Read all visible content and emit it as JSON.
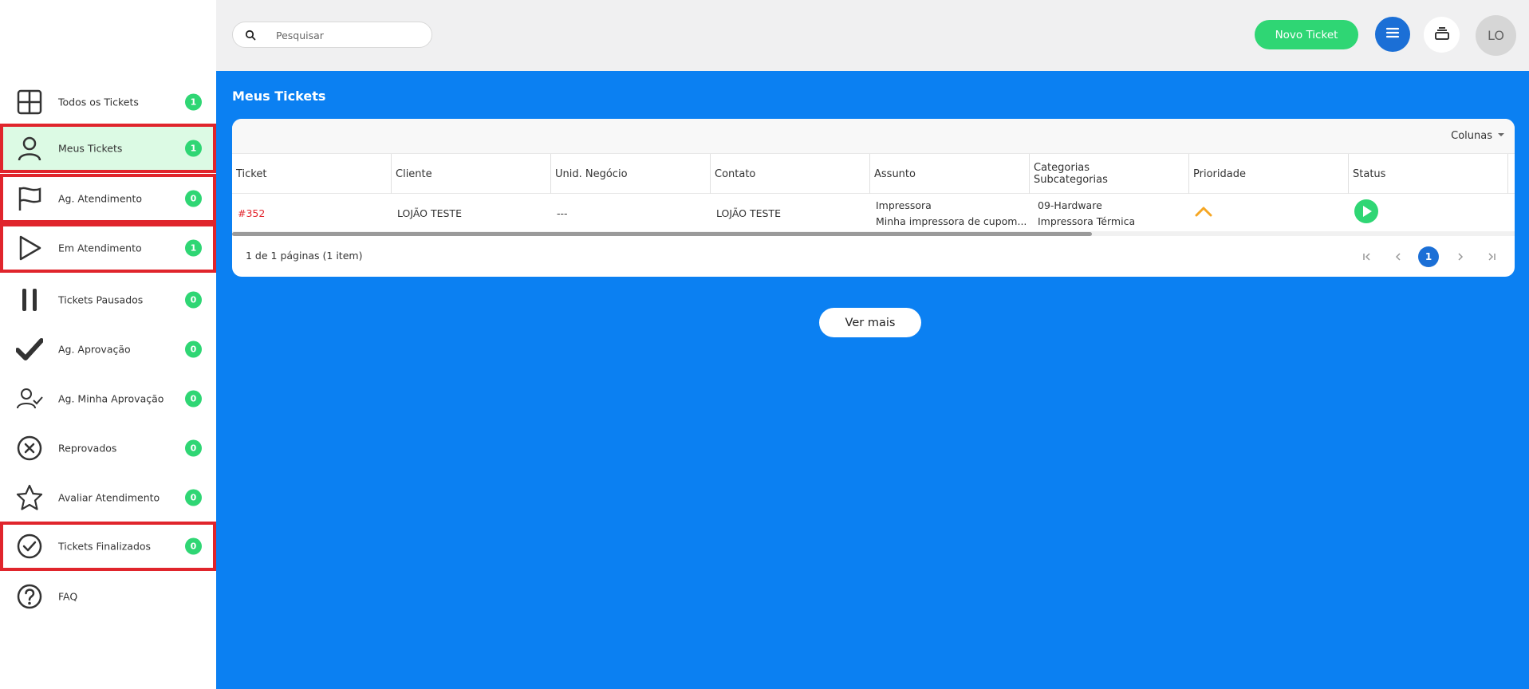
{
  "search": {
    "placeholder": "Pesquisar"
  },
  "header": {
    "new_ticket_label": "Novo Ticket",
    "avatar_initials": "LO"
  },
  "sidebar": {
    "items": [
      {
        "label": "Todos os Tickets",
        "count": "1",
        "icon": "grid-icon"
      },
      {
        "label": "Meus Tickets",
        "count": "1",
        "icon": "user-icon"
      },
      {
        "label": "Ag. Atendimento",
        "count": "0",
        "icon": "flag-icon"
      },
      {
        "label": "Em Atendimento",
        "count": "1",
        "icon": "play-icon"
      },
      {
        "label": "Tickets Pausados",
        "count": "0",
        "icon": "pause-icon"
      },
      {
        "label": "Ag. Aprovação",
        "count": "0",
        "icon": "check-icon"
      },
      {
        "label": "Ag. Minha Aprovação",
        "count": "0",
        "icon": "user-check-icon"
      },
      {
        "label": "Reprovados",
        "count": "0",
        "icon": "x-circle-icon"
      },
      {
        "label": "Avaliar Atendimento",
        "count": "0",
        "icon": "star-icon"
      },
      {
        "label": "Tickets Finalizados",
        "count": "0",
        "icon": "check-circle-icon"
      },
      {
        "label": "FAQ",
        "icon": "question-circle-icon"
      }
    ]
  },
  "main": {
    "title": "Meus Tickets",
    "columns_button": "Colunas",
    "table": {
      "headers": [
        "Ticket",
        "Cliente",
        "Unid. Negócio",
        "Contato",
        "Assunto",
        "Categorias",
        "Subcategorias",
        "Prioridade",
        "Status"
      ],
      "rows": [
        {
          "ticket": "#352",
          "cliente": "LOJÃO TESTE",
          "unid_negocio": "---",
          "contato": "LOJÃO TESTE",
          "assunto_1": "Impressora",
          "assunto_2": "Minha impressora de cupom...",
          "categoria": "09-Hardware",
          "subcategoria": "Impressora Térmica",
          "prioridade_icon": "chevron-up-icon",
          "status_icon": "play-circle-icon"
        }
      ]
    },
    "pager_info": "1 de 1 páginas (1 item)",
    "current_page": "1",
    "ver_mais": "Ver mais"
  },
  "colors": {
    "accent_green": "#2fd674",
    "main_blue": "#0b80f2",
    "button_blue": "#1b6fd6",
    "link_red": "#e3262e",
    "highlight_outline": "#e0252c",
    "priority_orange": "#f5a623"
  }
}
